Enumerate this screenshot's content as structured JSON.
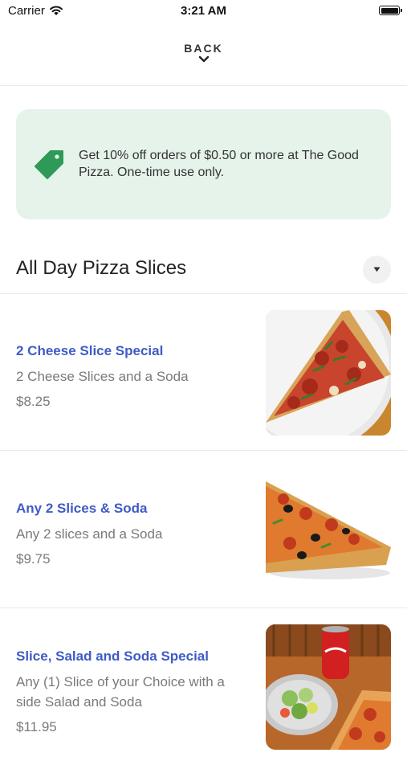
{
  "status_bar": {
    "carrier": "Carrier",
    "time": "3:21 AM"
  },
  "header": {
    "back_label": "BACK"
  },
  "promo": {
    "text": "Get 10% off orders of $0.50 or more at The Good Pizza. One-time use only.",
    "background": "#e5f3ea",
    "icon": "tag-icon",
    "icon_color": "#2e9a57"
  },
  "section": {
    "title": "All Day Pizza Slices",
    "toggle_icon": "caret-down-icon"
  },
  "items": [
    {
      "name": "2 Cheese Slice Special",
      "description": "2 Cheese Slices and a Soda",
      "price": "$8.25"
    },
    {
      "name": "Any 2 Slices & Soda",
      "description": "Any 2 slices and a Soda",
      "price": "$9.75"
    },
    {
      "name": "Slice, Salad and Soda Special",
      "description": "Any (1) Slice of your Choice with a side Salad and Soda",
      "price": "$11.95"
    }
  ],
  "colors": {
    "item_name": "#3f5bc7",
    "muted_text": "#7a7a7a"
  }
}
